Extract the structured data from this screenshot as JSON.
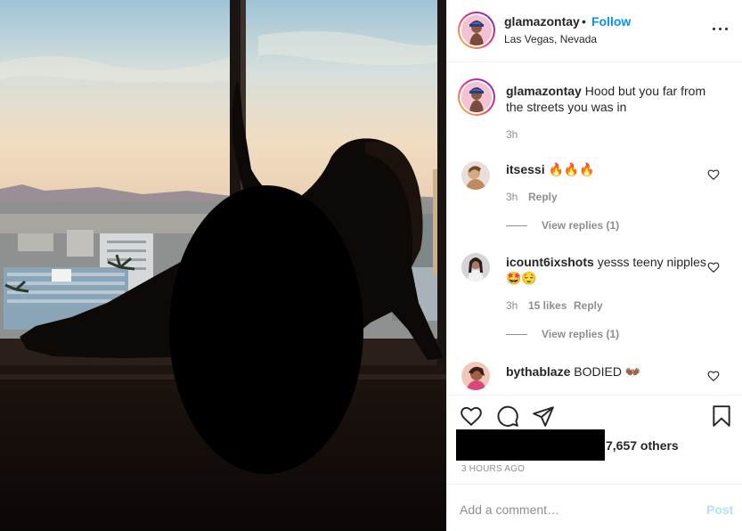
{
  "post": {
    "image_alt": "Silhouette photo by a hotel window overlooking Las Vegas",
    "colors": {
      "sky_top": "#9fc4d6",
      "sky_horizon": "#f4e1c4",
      "silhouette": "#0d0907",
      "censor": "#000000"
    }
  },
  "header": {
    "username": "glamazontay",
    "separator": "•",
    "follow_label": "Follow",
    "location": "Las Vegas, Nevada",
    "more_icon": "more-horizontal-icon"
  },
  "caption": {
    "username": "glamazontay",
    "text": "Hood but you far from the streets you was in",
    "time": "3h"
  },
  "comments": [
    {
      "username": "itsessi",
      "text": "🔥🔥🔥",
      "time": "3h",
      "likes": "",
      "reply_label": "Reply",
      "view_replies": "View replies (1)"
    },
    {
      "username": "icount6ixshots",
      "text": "yesss teeny nipples 🤩😌",
      "time": "3h",
      "likes": "15 likes",
      "reply_label": "Reply",
      "view_replies": "View replies (1)"
    },
    {
      "username": "bythablaze",
      "text": "BODIED 👐🏾",
      "time": "",
      "likes": "",
      "reply_label": "",
      "view_replies": ""
    }
  ],
  "actions": {
    "like_icon": "heart-icon",
    "comment_icon": "comment-icon",
    "share_icon": "paper-plane-icon",
    "save_icon": "bookmark-icon",
    "likes_text": "7,657 others",
    "timestamp": "3 HOURS AGO"
  },
  "add_comment": {
    "placeholder": "Add a comment…",
    "post_label": "Post"
  },
  "colors": {
    "accent": "#0095f6",
    "post_disabled": "#b2dffc",
    "secondary_text": "#8e8e8e"
  }
}
